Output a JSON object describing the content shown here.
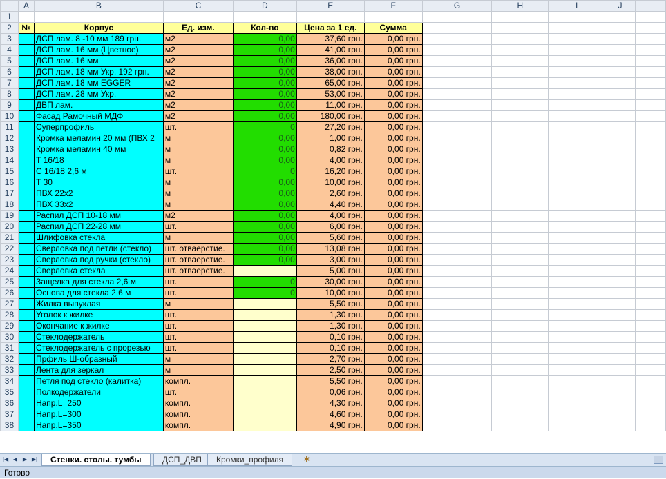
{
  "columns": [
    "A",
    "B",
    "C",
    "D",
    "E",
    "F",
    "G",
    "H",
    "I",
    "J"
  ],
  "header_row": {
    "row_num": "2",
    "a": "№",
    "b": "Корпус",
    "c": "Ед. изм.",
    "d": "Кол-во",
    "e": "Цена за 1 ед.",
    "f": "Сумма"
  },
  "rows": [
    {
      "n": "3",
      "b": "ДСП лам. 8 -10 мм  189 грн.",
      "c": "м2",
      "d": "0,00",
      "e": "37,60 грн.",
      "f": "0,00 грн.",
      "dstyle": "green"
    },
    {
      "n": "4",
      "b": "ДСП лам. 16 мм (Цветное)",
      "c": "м2",
      "d": "0,00",
      "e": "41,00 грн.",
      "f": "0,00 грн.",
      "dstyle": "green"
    },
    {
      "n": "5",
      "b": "ДСП лам. 16 мм",
      "c": "м2",
      "d": "0,00",
      "e": "36,00 грн.",
      "f": "0,00 грн.",
      "dstyle": "green"
    },
    {
      "n": "6",
      "b": "ДСП лам. 18 мм Укр. 192 грн.",
      "c": "м2",
      "d": "0,00",
      "e": "38,00 грн.",
      "f": "0,00 грн.",
      "dstyle": "green"
    },
    {
      "n": "7",
      "b": "ДСП лам. 18 мм EGGER",
      "c": "м2",
      "d": "0,00",
      "e": "65,00 грн.",
      "f": "0,00 грн.",
      "dstyle": "green"
    },
    {
      "n": "8",
      "b": "ДСП лам. 28 мм Укр.",
      "c": "м2",
      "d": "0,00",
      "e": "53,00 грн.",
      "f": "0,00 грн.",
      "dstyle": "green"
    },
    {
      "n": "9",
      "b": "ДВП лам.",
      "c": "м2",
      "d": "0,00",
      "e": "11,00 грн.",
      "f": "0,00 грн.",
      "dstyle": "green"
    },
    {
      "n": "10",
      "b": "Фасад Рамочный МДФ",
      "c": "м2",
      "d": "0,00",
      "e": "180,00 грн.",
      "f": "0,00 грн.",
      "dstyle": "green"
    },
    {
      "n": "11",
      "b": "Суперпрофиль",
      "c": "шт.",
      "d": "0",
      "e": "27,20 грн.",
      "f": "0,00 грн.",
      "dstyle": "green"
    },
    {
      "n": "12",
      "b": "Кромка меламин 20 мм (ПВХ 2",
      "c": "м",
      "d": "0,00",
      "e": "1,00 грн.",
      "f": "0,00 грн.",
      "dstyle": "green"
    },
    {
      "n": "13",
      "b": "Кромка меламин 40 мм",
      "c": "м",
      "d": "0,00",
      "e": "0,82 грн.",
      "f": "0,00 грн.",
      "dstyle": "green"
    },
    {
      "n": "14",
      "b": "Т 16/18",
      "c": "м",
      "d": "0,00",
      "e": "4,00 грн.",
      "f": "0,00 грн.",
      "dstyle": "green"
    },
    {
      "n": "15",
      "b": "С 16/18       2,6 м",
      "c": "шт.",
      "d": "0",
      "e": "16,20 грн.",
      "f": "0,00 грн.",
      "dstyle": "green"
    },
    {
      "n": "16",
      "b": "Т 30",
      "c": "м",
      "d": "0,00",
      "e": "10,00 грн.",
      "f": "0,00 грн.",
      "dstyle": "green"
    },
    {
      "n": "17",
      "b": "ПВХ 22х2",
      "c": "м",
      "d": "0,00",
      "e": "2,60 грн.",
      "f": "0,00 грн.",
      "dstyle": "green"
    },
    {
      "n": "18",
      "b": "ПВХ 33х2",
      "c": "м",
      "d": "0,00",
      "e": "4,40 грн.",
      "f": "0,00 грн.",
      "dstyle": "green"
    },
    {
      "n": "19",
      "b": "Распил ДСП 10-18 мм",
      "c": "м2",
      "d": "0,00",
      "e": "4,00 грн.",
      "f": "0,00 грн.",
      "dstyle": "green"
    },
    {
      "n": "20",
      "b": "Распил ДСП 22-28 мм",
      "c": "шт.",
      "d": "0,00",
      "e": "6,00 грн.",
      "f": "0,00 грн.",
      "dstyle": "green"
    },
    {
      "n": "21",
      "b": "Шлифовка стекла",
      "c": "м",
      "d": "0,00",
      "e": "5,60 грн.",
      "f": "0,00 грн.",
      "dstyle": "green"
    },
    {
      "n": "22",
      "b": "Сверловка под петли (стекло)",
      "c": "шт. отваерстие.",
      "d": "0,00",
      "e": "13,08 грн.",
      "f": "0,00 грн.",
      "dstyle": "green"
    },
    {
      "n": "23",
      "b": "Сверловка под ручки (стекло)",
      "c": "шт. отваерстие.",
      "d": "0,00",
      "e": "3,00 грн.",
      "f": "0,00 грн.",
      "dstyle": "green"
    },
    {
      "n": "24",
      "b": "Сверловка  стекла",
      "c": "шт. отваерстие.",
      "d": "",
      "e": "5,00 грн.",
      "f": "0,00 грн.",
      "dstyle": "pale"
    },
    {
      "n": "25",
      "b": "Защелка для стекла 2,6 м",
      "c": "шт.",
      "d": "0",
      "e": "30,00 грн.",
      "f": "0,00 грн.",
      "dstyle": "green"
    },
    {
      "n": "26",
      "b": "Основа для стекла 2,6 м",
      "c": "шт.",
      "d": "0",
      "e": "10,00 грн.",
      "f": "0,00 грн.",
      "dstyle": "green"
    },
    {
      "n": "27",
      "b": "Жилка выпуклая",
      "c": "м",
      "d": "",
      "e": "5,50 грн.",
      "f": "0,00 грн.",
      "dstyle": "pale"
    },
    {
      "n": "28",
      "b": "Уголок к жилке",
      "c": "шт.",
      "d": "",
      "e": "1,30 грн.",
      "f": "0,00 грн.",
      "dstyle": "pale"
    },
    {
      "n": "29",
      "b": "Окончание к жилке",
      "c": "шт.",
      "d": "",
      "e": "1,30 грн.",
      "f": "0,00 грн.",
      "dstyle": "pale"
    },
    {
      "n": "30",
      "b": "Стеклодержатель",
      "c": "шт.",
      "d": "",
      "e": "0,10 грн.",
      "f": "0,00 грн.",
      "dstyle": "pale"
    },
    {
      "n": "31",
      "b": "Стеклодержатель с прорезью",
      "c": "шт.",
      "d": "",
      "e": "0,10 грн.",
      "f": "0,00 грн.",
      "dstyle": "pale"
    },
    {
      "n": "32",
      "b": "Прфиль Ш-образный",
      "c": "м",
      "d": "",
      "e": "2,70 грн.",
      "f": "0,00 грн.",
      "dstyle": "pale"
    },
    {
      "n": "33",
      "b": "Лента для зеркал",
      "c": "м",
      "d": "",
      "e": "2,50 грн.",
      "f": "0,00 грн.",
      "dstyle": "pale"
    },
    {
      "n": "34",
      "b": "Петля под стекло (калитка)",
      "c": "компл.",
      "d": "",
      "e": "5,50 грн.",
      "f": "0,00 грн.",
      "dstyle": "pale"
    },
    {
      "n": "35",
      "b": "Полкодержатели",
      "c": "шт.",
      "d": "",
      "e": "0,06 грн.",
      "f": "0,00 грн.",
      "dstyle": "pale"
    },
    {
      "n": "36",
      "b": "Напр.L=250",
      "c": "компл.",
      "d": "",
      "e": "4,30 грн.",
      "f": "0,00 грн.",
      "dstyle": "pale"
    },
    {
      "n": "37",
      "b": "Напр.L=300",
      "c": "компл.",
      "d": "",
      "e": "4,60 грн.",
      "f": "0,00 грн.",
      "dstyle": "pale"
    },
    {
      "n": "38",
      "b": "Напр.L=350",
      "c": "компл.",
      "d": "",
      "e": "4,90 грн.",
      "f": "0,00 грн.",
      "dstyle": "pale"
    }
  ],
  "tabs": [
    {
      "label": "Стенки. столы. тумбы",
      "active": true
    },
    {
      "label": "ДСП_ДВП",
      "active": false
    },
    {
      "label": "Кромки_профиля",
      "active": false
    }
  ],
  "status": "Готово",
  "colors": {
    "yellow": "#ffff99",
    "cyan": "#00ffff",
    "peach": "#fcc79a",
    "green": "#22dd00",
    "pale": "#ffffcc"
  }
}
